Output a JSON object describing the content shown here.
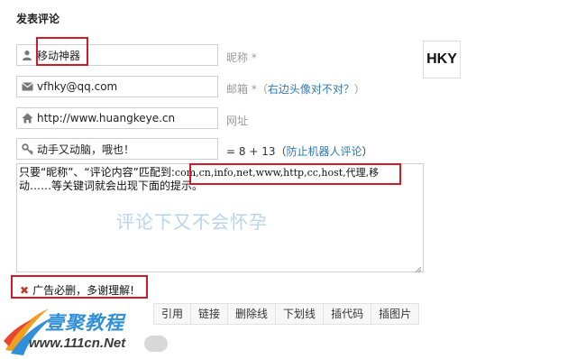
{
  "form": {
    "title": "发表评论",
    "name": {
      "value": "移动神器",
      "label": "昵称 *"
    },
    "email": {
      "value": "vfhky@qq.com",
      "label": "邮箱 *（",
      "link": "右边头像对不对？",
      "label_end": "）"
    },
    "url": {
      "value": "http://www.huangkeye.cn",
      "label": "网址"
    },
    "captcha": {
      "value": "动手又动脑，哦也！",
      "label": "= 8 + 13（",
      "link": "防止机器人评论",
      "label_end": "）"
    },
    "avatar_text": "HKY",
    "comment": {
      "text_part1": "只要“昵称”、“评论内容”匹配到:",
      "keywords": "com,cn,info,net,www,http,cc,host,代理,移",
      "text_part2": "动……等关键词就会出现下面的提示。",
      "watermark": "评论下又不会怀孕"
    },
    "warning": "广告必删，多谢理解!"
  },
  "toolbar": {
    "buttons": [
      "引用",
      "链接",
      "删除线",
      "下划线",
      "插代码",
      "插图片"
    ]
  },
  "logo": {
    "cn": "壹聚教程",
    "en": "www.111cn.Net"
  },
  "colors": {
    "highlight": "#d11a2a",
    "link": "#2a7ab8",
    "watermark": "#b8d4ec",
    "logo_blue": "#2f8fd8"
  }
}
